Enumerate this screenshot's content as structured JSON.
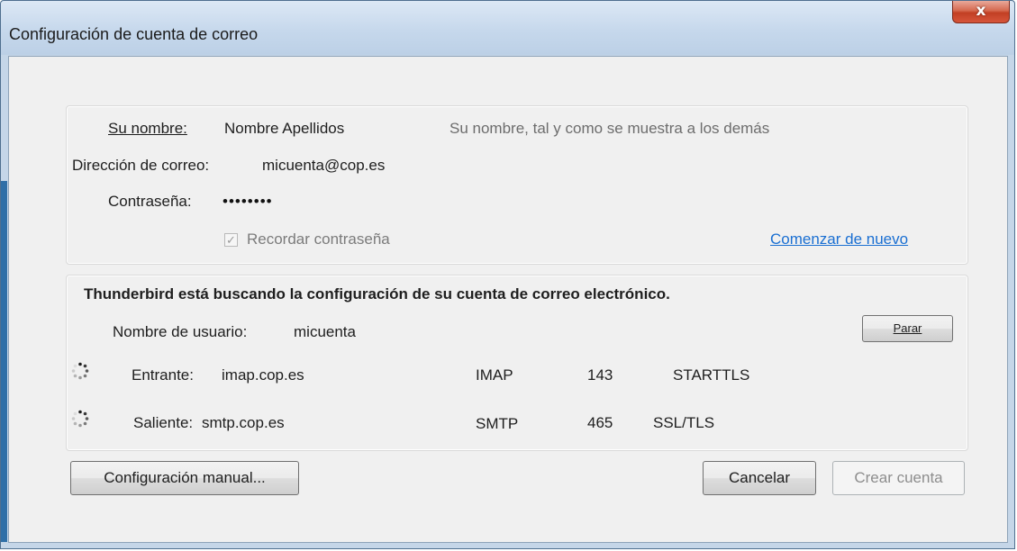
{
  "window": {
    "title": "Configuración de cuenta de correo",
    "close_glyph": "x"
  },
  "identity": {
    "name_label": "Su nombre:",
    "name_value": "Nombre Apellidos",
    "name_hint": "Su nombre, tal y como se muestra a los demás",
    "email_label": "Dirección de correo:",
    "email_value": "micuenta@cop.es",
    "password_label": "Contraseña:",
    "password_value": "••••••••",
    "remember_label": "Recordar contraseña",
    "remember_checked": true,
    "restart_link": "Comenzar de nuevo"
  },
  "status": {
    "message": "Thunderbird está buscando la configuración de su cuenta de correo electrónico.",
    "username_label": "Nombre de usuario:",
    "username_value": "micuenta",
    "stop_button": "Parar",
    "incoming": {
      "label": "Entrante:",
      "server": "imap.cop.es",
      "protocol": "IMAP",
      "port": "143",
      "security": "STARTTLS",
      "icon": "spinner-icon"
    },
    "outgoing": {
      "label": "Saliente:",
      "server": "smtp.cop.es",
      "protocol": "SMTP",
      "port": "465",
      "security": "SSL/TLS",
      "icon": "spinner-icon"
    }
  },
  "buttons": {
    "manual_config": "Configuración manual...",
    "cancel": "Cancelar",
    "create_account": "Crear cuenta"
  },
  "colors": {
    "link": "#1a6fd2",
    "close_button": "#c23f24",
    "title_bar": "#c6d8ec"
  }
}
